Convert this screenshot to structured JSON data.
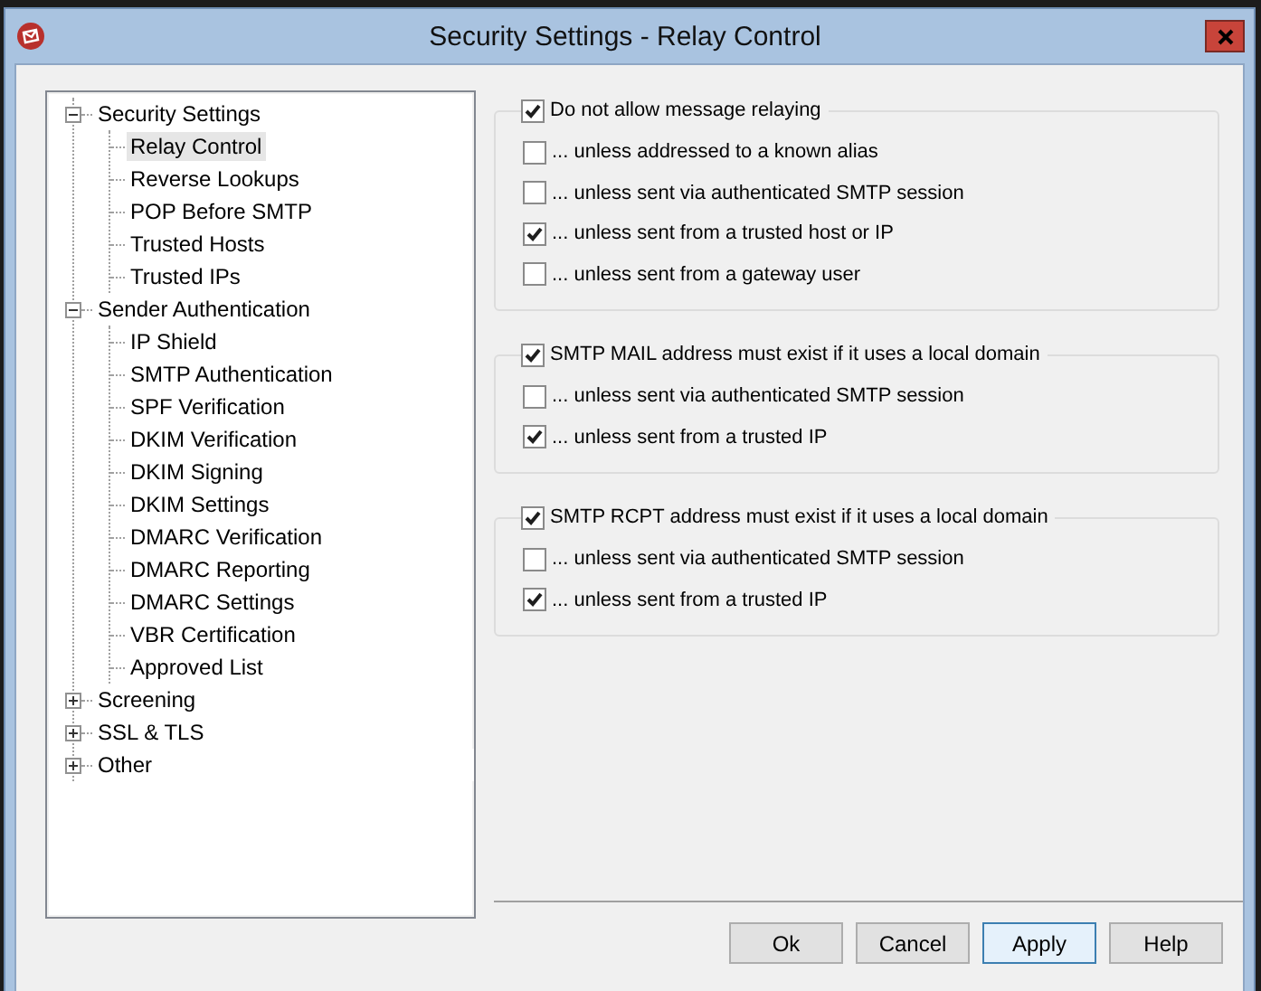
{
  "window": {
    "title": "Security Settings - Relay Control"
  },
  "tree": [
    {
      "label": "Security Settings",
      "expanded": true,
      "selected": false,
      "children": [
        {
          "label": "Relay Control",
          "selected": true
        },
        {
          "label": "Reverse Lookups",
          "selected": false
        },
        {
          "label": "POP Before SMTP",
          "selected": false
        },
        {
          "label": "Trusted Hosts",
          "selected": false
        },
        {
          "label": "Trusted IPs",
          "selected": false
        }
      ]
    },
    {
      "label": "Sender Authentication",
      "expanded": true,
      "selected": false,
      "children": [
        {
          "label": "IP Shield",
          "selected": false
        },
        {
          "label": "SMTP Authentication",
          "selected": false
        },
        {
          "label": "SPF Verification",
          "selected": false
        },
        {
          "label": "DKIM Verification",
          "selected": false
        },
        {
          "label": "DKIM Signing",
          "selected": false
        },
        {
          "label": "DKIM Settings",
          "selected": false
        },
        {
          "label": "DMARC Verification",
          "selected": false
        },
        {
          "label": "DMARC Reporting",
          "selected": false
        },
        {
          "label": "DMARC Settings",
          "selected": false
        },
        {
          "label": "VBR Certification",
          "selected": false
        },
        {
          "label": "Approved List",
          "selected": false
        }
      ]
    },
    {
      "label": "Screening",
      "expanded": false,
      "selected": false
    },
    {
      "label": "SSL & TLS",
      "expanded": false,
      "selected": false
    },
    {
      "label": "Other",
      "expanded": false,
      "selected": false
    }
  ],
  "groups": [
    {
      "header": {
        "label": "Do not allow message relaying",
        "checked": true
      },
      "options": [
        {
          "label": "... unless addressed to a known alias",
          "checked": false
        },
        {
          "label": "... unless sent via authenticated SMTP session",
          "checked": false
        },
        {
          "label": "... unless sent from a trusted host or IP",
          "checked": true
        },
        {
          "label": "... unless sent from a gateway user",
          "checked": false
        }
      ]
    },
    {
      "header": {
        "label": "SMTP MAIL address must exist if it uses a local domain",
        "checked": true
      },
      "options": [
        {
          "label": "... unless sent via authenticated SMTP session",
          "checked": false
        },
        {
          "label": "... unless sent from a trusted IP",
          "checked": true
        }
      ]
    },
    {
      "header": {
        "label": "SMTP RCPT address must exist if it uses a local domain",
        "checked": true
      },
      "options": [
        {
          "label": "... unless sent via authenticated SMTP session",
          "checked": false
        },
        {
          "label": "... unless sent from a trusted IP",
          "checked": true
        }
      ]
    }
  ],
  "buttons": [
    {
      "label": "Ok",
      "default": false
    },
    {
      "label": "Cancel",
      "default": false
    },
    {
      "label": "Apply",
      "default": true
    },
    {
      "label": "Help",
      "default": false
    }
  ]
}
